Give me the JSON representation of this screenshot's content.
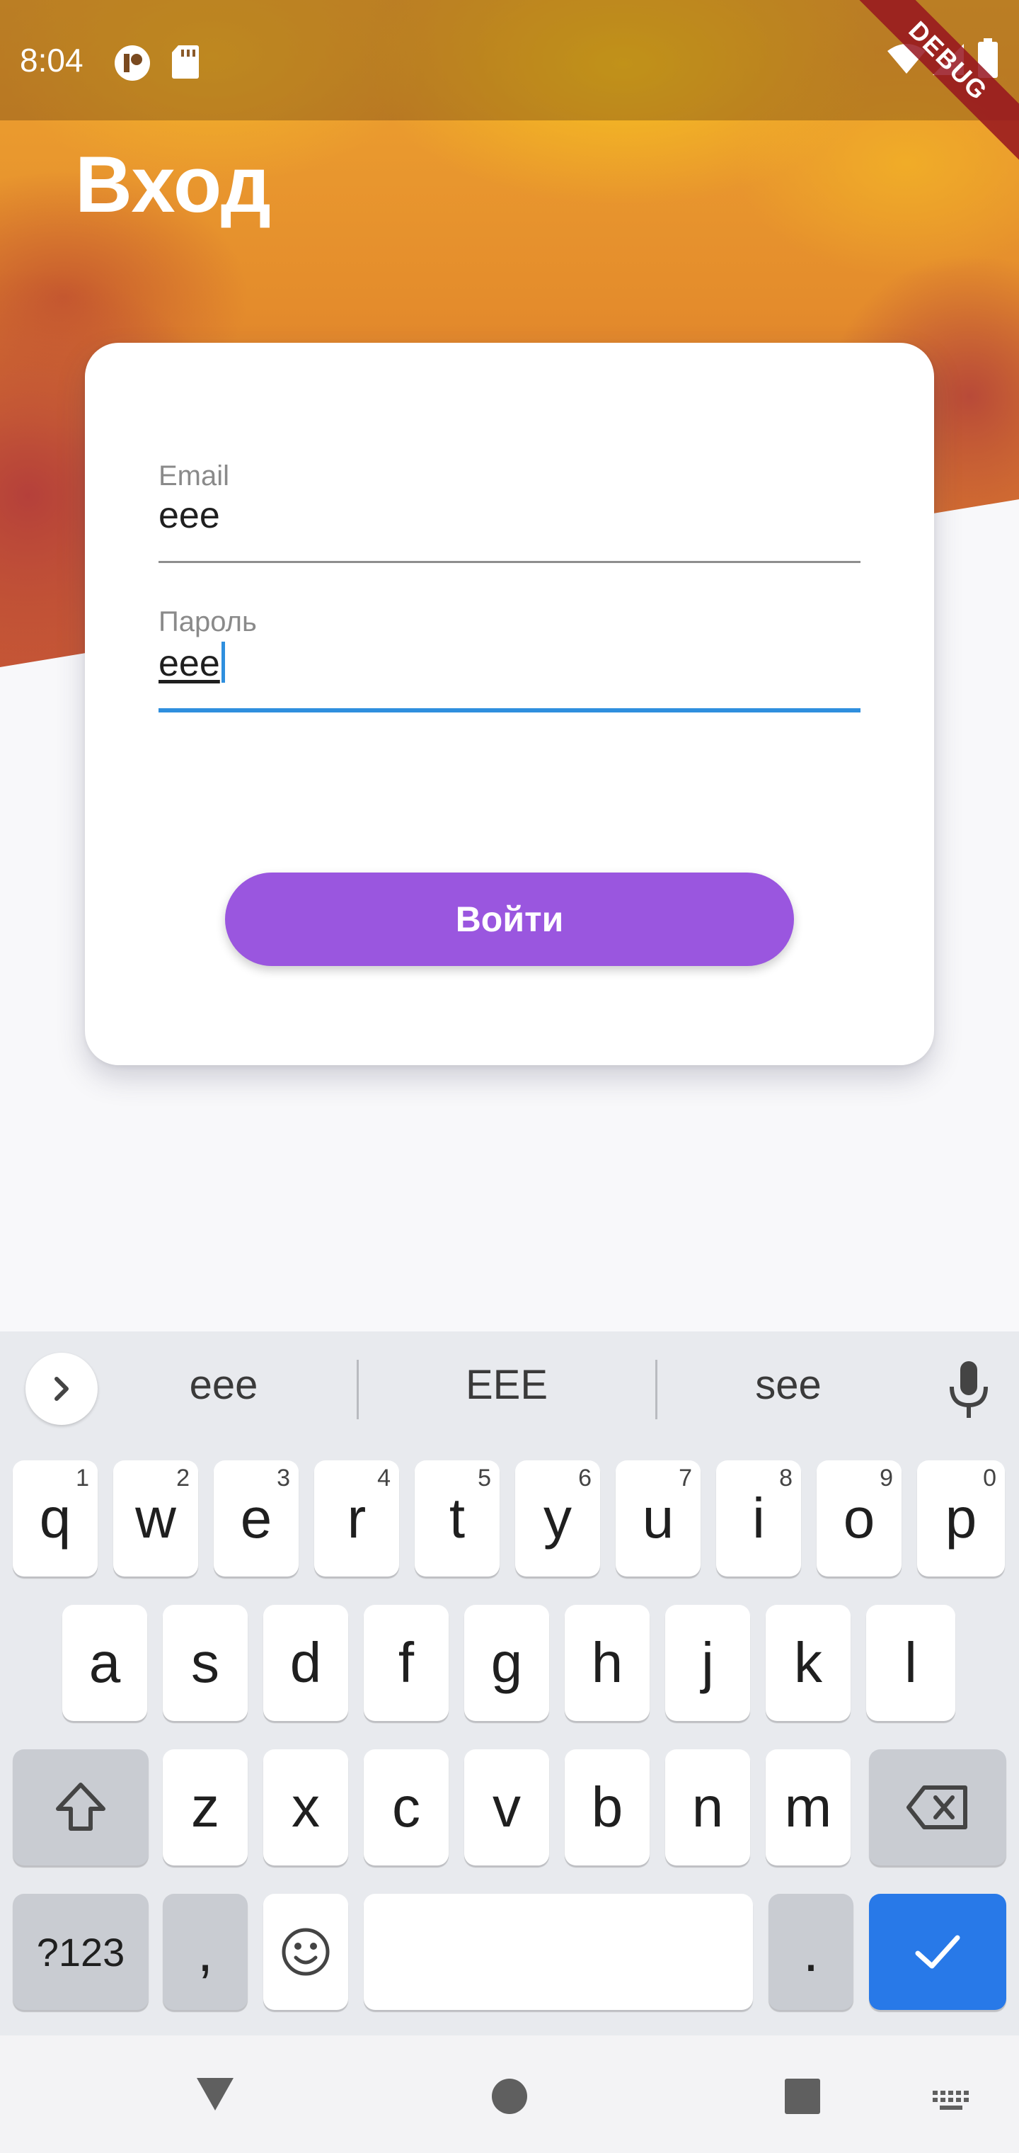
{
  "status_bar": {
    "time": "8:04",
    "icons": [
      "notification-app-icon",
      "sd-card-icon",
      "wifi-icon",
      "signal-icon",
      "battery-icon"
    ],
    "debug_banner": "DEBUG"
  },
  "header": {
    "title": "Вход"
  },
  "form": {
    "email": {
      "label": "Email",
      "value": "eee"
    },
    "password": {
      "label": "Пароль",
      "value": "eee"
    },
    "submit_label": "Войти"
  },
  "colors": {
    "accent_button": "#9a56df",
    "focus_underline": "#2f8fde",
    "keyboard_action": "#2879e8"
  },
  "keyboard": {
    "suggestions": [
      "eee",
      "EEE",
      "see"
    ],
    "row1": [
      {
        "key": "q",
        "hint": "1"
      },
      {
        "key": "w",
        "hint": "2"
      },
      {
        "key": "e",
        "hint": "3"
      },
      {
        "key": "r",
        "hint": "4"
      },
      {
        "key": "t",
        "hint": "5"
      },
      {
        "key": "y",
        "hint": "6"
      },
      {
        "key": "u",
        "hint": "7"
      },
      {
        "key": "i",
        "hint": "8"
      },
      {
        "key": "o",
        "hint": "9"
      },
      {
        "key": "p",
        "hint": "0"
      }
    ],
    "row2": [
      "a",
      "s",
      "d",
      "f",
      "g",
      "h",
      "j",
      "k",
      "l"
    ],
    "row3": [
      "z",
      "x",
      "c",
      "v",
      "b",
      "n",
      "m"
    ],
    "symbols_label": "?123",
    "comma": ",",
    "period": "."
  },
  "nav_bar": {
    "icons": [
      "back-icon",
      "home-icon",
      "recents-icon",
      "keyboard-switch-icon"
    ]
  }
}
